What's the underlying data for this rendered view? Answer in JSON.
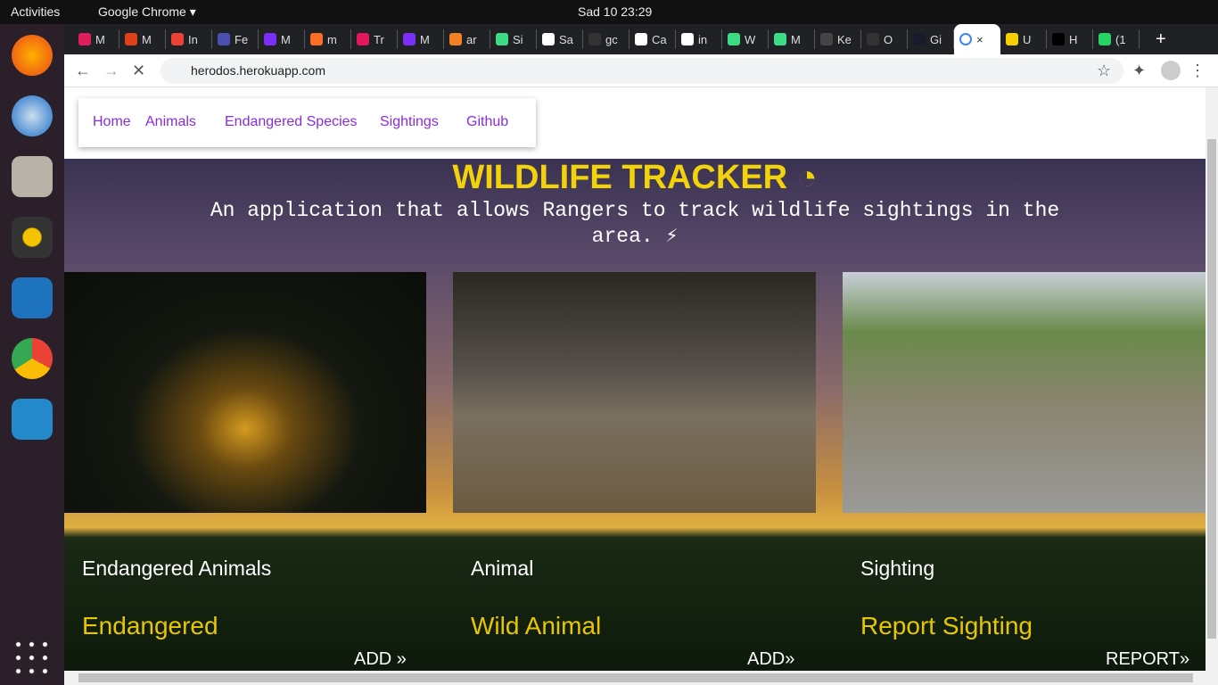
{
  "system": {
    "activities": "Activities",
    "app": "Google Chrome ▾",
    "clock": "Sad 10  23:29"
  },
  "tabs": [
    {
      "t": "M",
      "c": "#e01e5a"
    },
    {
      "t": "M",
      "c": "#e0401a"
    },
    {
      "t": "In",
      "c": "#ea4335"
    },
    {
      "t": "Fe",
      "c": "#4b4fb0"
    },
    {
      "t": "M",
      "c": "#7b2ff7"
    },
    {
      "t": "m",
      "c": "#fc6d26"
    },
    {
      "t": "Tr",
      "c": "#e2185b"
    },
    {
      "t": "M",
      "c": "#7b2ff7"
    },
    {
      "t": "ar",
      "c": "#f48024"
    },
    {
      "t": "Si",
      "c": "#3ddc84"
    },
    {
      "t": "Sa",
      "c": "#ffffff"
    },
    {
      "t": "gc",
      "c": "#333333"
    },
    {
      "t": "Ca",
      "c": "#ffffff"
    },
    {
      "t": "in",
      "c": "#ffffff"
    },
    {
      "t": "W",
      "c": "#3ddc84"
    },
    {
      "t": "M",
      "c": "#3ddc84"
    },
    {
      "t": "Ke",
      "c": "#444444"
    },
    {
      "t": "O",
      "c": "#333333"
    },
    {
      "t": "Gi",
      "c": "#1a1a2e"
    },
    {
      "t": "×",
      "c": "#4285f4",
      "active": true
    },
    {
      "t": "U",
      "c": "#f5d000"
    },
    {
      "t": "H",
      "c": "#000000"
    },
    {
      "t": "(1",
      "c": "#25d366"
    }
  ],
  "browser": {
    "url": "herodos.herokuapp.com",
    "new_tab": "+"
  },
  "nav": {
    "home": "Home",
    "animals": "Animals",
    "endangered": "Endangered Species",
    "sightings": "Sightings",
    "github": "Github"
  },
  "hero": {
    "title": "WILDLIFE TRACKER",
    "subtitle": "An application that allows Rangers to track wildlife sightings in the area.  ⚡"
  },
  "cards": [
    {
      "heading": "Endangered Animals",
      "link": "Endangered",
      "action": "ADD »"
    },
    {
      "heading": "Animal",
      "link": "Wild Animal",
      "action": "ADD»"
    },
    {
      "heading": "Sighting",
      "link": "Report Sighting",
      "action": "REPORT»"
    }
  ]
}
